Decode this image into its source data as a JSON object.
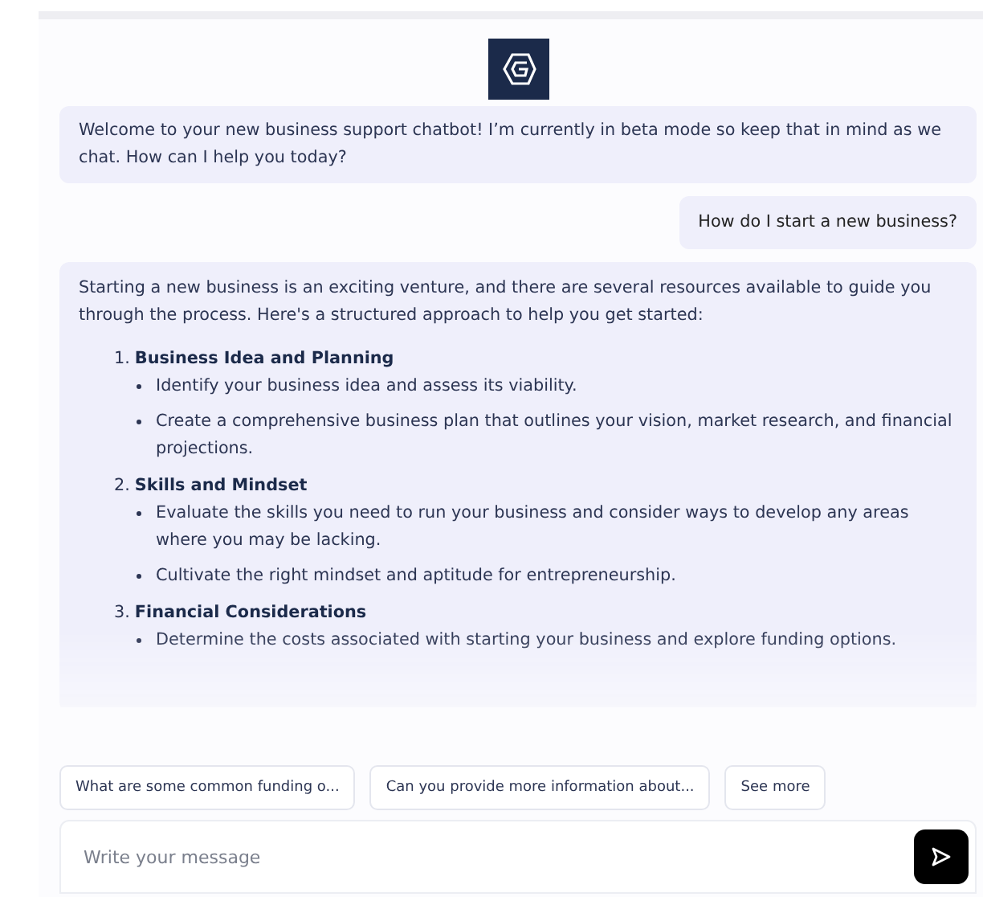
{
  "messages": [
    {
      "kind": "bot",
      "text": "Welcome to your new business support chatbot! I’m currently in beta mode so keep that in mind as we chat. How can I help you today?"
    },
    {
      "kind": "user",
      "text": "How do I start a new business?"
    },
    {
      "kind": "answer",
      "intro": "Starting a new business is an exciting venture, and there are several resources available to guide you through the process. Here's a structured approach to help you get started:",
      "sections": [
        {
          "number": "1.",
          "title": "Business Idea and Planning",
          "points": [
            "Identify your business idea and assess its viability.",
            "Create a comprehensive business plan that outlines your vision, market research, and financial projections."
          ]
        },
        {
          "number": "2.",
          "title": "Skills and Mindset",
          "points": [
            "Evaluate the skills you need to run your business and consider ways to develop any areas where you may be lacking.",
            "Cultivate the right mindset and aptitude for entrepreneurship."
          ]
        },
        {
          "number": "3.",
          "title": "Financial Considerations",
          "points": [
            "Determine the costs associated with starting your business and explore funding options."
          ]
        }
      ]
    }
  ],
  "suggestions": [
    "What are some common funding o...",
    "Can you provide more information about...",
    "See more"
  ],
  "composer": {
    "placeholder": "Write your message"
  }
}
